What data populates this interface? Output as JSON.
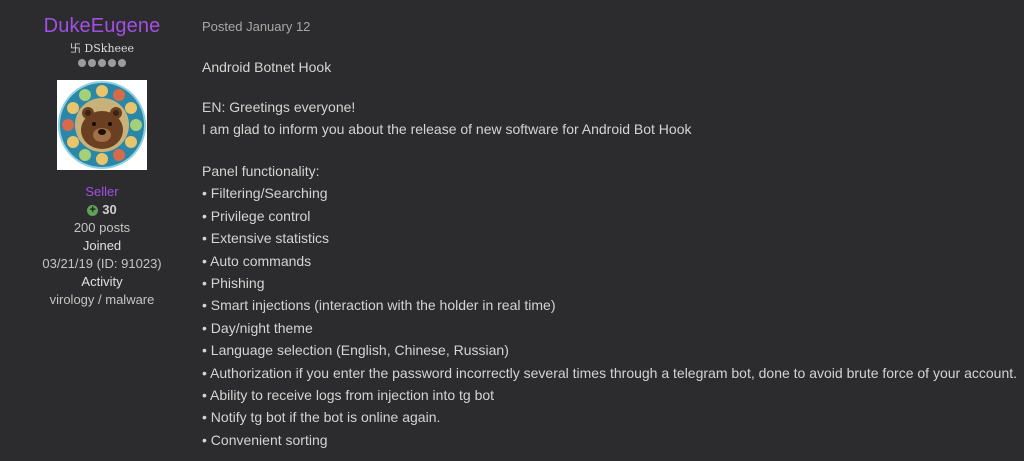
{
  "author": {
    "username": "DukeEugene",
    "title": "卐 DSkheee",
    "group": "Seller",
    "reputation": "30",
    "posts": "200 posts",
    "joined_label": "Joined",
    "joined_value": "03/21/19 (ID: 91023)",
    "activity_label": "Activity",
    "activity_value": "virology / malware",
    "rank_pips": 5,
    "colors": {
      "username": "#a24fe3",
      "group": "#a24fe3",
      "reputation_icon": "#5fa05a"
    }
  },
  "post": {
    "posted": "Posted January 12",
    "title": "Android Botnet Hook",
    "intro": [
      "EN: Greetings everyone!",
      "I am glad to inform you about the release of new software for Android Bot Hook"
    ],
    "functionality_heading": "Panel functionality:",
    "features": [
      "• Filtering/Searching",
      "• Privilege control",
      "• Extensive statistics",
      "• Auto commands",
      "• Phishing",
      "• Smart injections (interaction with the holder in real time)",
      "• Day/night theme",
      "• Language selection (English, Chinese, Russian)",
      "• Authorization if you enter the password incorrectly several times through a telegram bot, done to avoid brute force of your account.",
      "• Ability to receive logs from injection into tg bot",
      "• Notify tg bot if the bot is online again.",
      "• Convenient sorting"
    ]
  }
}
